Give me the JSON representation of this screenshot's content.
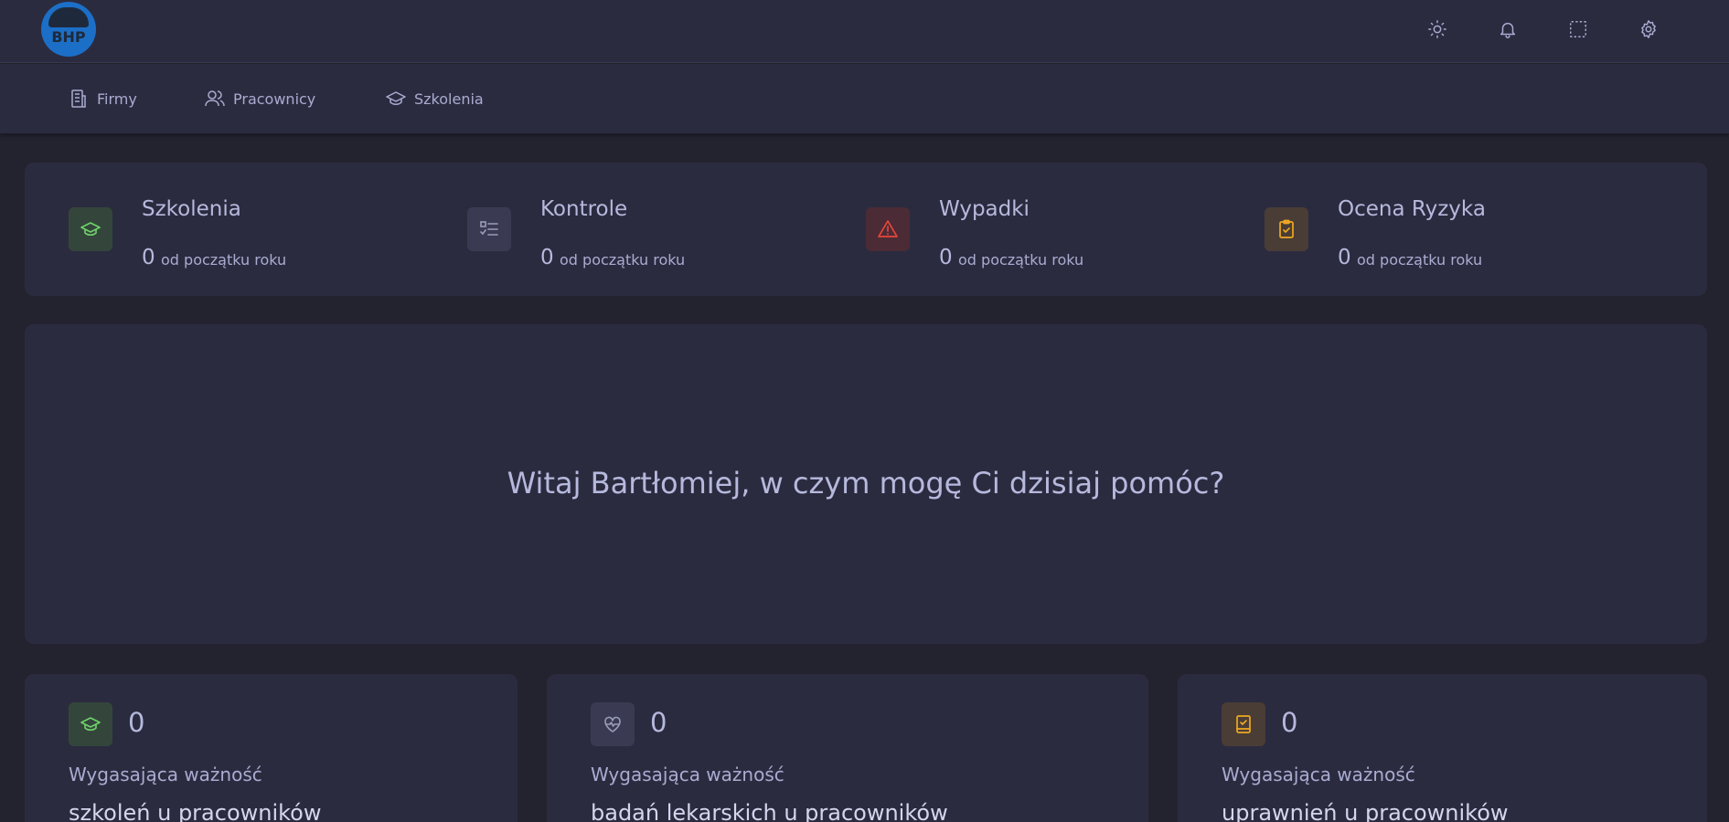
{
  "app": {
    "logo_text": "BHP"
  },
  "topbar": {
    "icons": [
      "sun-icon",
      "bell-icon",
      "fullscreen-icon",
      "gear-icon"
    ]
  },
  "nav": {
    "items": [
      {
        "label": "Firmy",
        "icon": "building-icon"
      },
      {
        "label": "Pracownicy",
        "icon": "users-icon"
      },
      {
        "label": "Szkolenia",
        "icon": "graduation-cap-icon"
      }
    ]
  },
  "stats": [
    {
      "title": "Szkolenia",
      "value": "0",
      "sub": "od początku roku",
      "icon": "graduation-cap-icon",
      "color": "#6fd36a",
      "bg": "#34463b"
    },
    {
      "title": "Kontrole",
      "value": "0",
      "sub": "od początku roku",
      "icon": "checklist-icon",
      "color": "#9a9db8",
      "bg": "#3a3b52"
    },
    {
      "title": "Wypadki",
      "value": "0",
      "sub": "od początku roku",
      "icon": "warning-icon",
      "color": "#e6453a",
      "bg": "#4b2b35"
    },
    {
      "title": "Ocena Ryzyka",
      "value": "0",
      "sub": "od początku roku",
      "icon": "clipboard-check-icon",
      "color": "#f0a822",
      "bg": "#4a3d35"
    }
  ],
  "welcome": {
    "text": "Witaj Bartłomiej, w czym mogę Ci dzisiaj pomóc?"
  },
  "expiry_cards": [
    {
      "value": "0",
      "label": "Wygasająca ważność",
      "desc": "szkoleń u pracowników",
      "icon": "graduation-cap-icon",
      "color": "#6fd36a",
      "bg": "#34463b"
    },
    {
      "value": "0",
      "label": "Wygasająca ważność",
      "desc": "badań lekarskich u pracowników",
      "icon": "heart-pulse-icon",
      "color": "#9a9db8",
      "bg": "#3a3b52"
    },
    {
      "value": "0",
      "label": "Wygasająca ważność",
      "desc": "uprawnień u pracowników",
      "icon": "book-check-icon",
      "color": "#f0a822",
      "bg": "#4a3d35"
    }
  ]
}
